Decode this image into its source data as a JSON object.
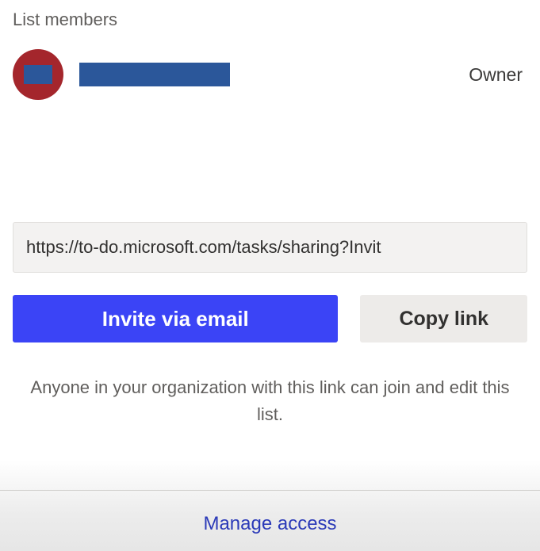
{
  "section_title": "List members",
  "member": {
    "role": "Owner"
  },
  "share": {
    "link_url": "https://to-do.microsoft.com/tasks/sharing?Invit",
    "invite_button_label": "Invite via email",
    "copy_button_label": "Copy link",
    "info_text": "Anyone in your organization with this link can join and edit this list."
  },
  "manage_access_label": "Manage access"
}
